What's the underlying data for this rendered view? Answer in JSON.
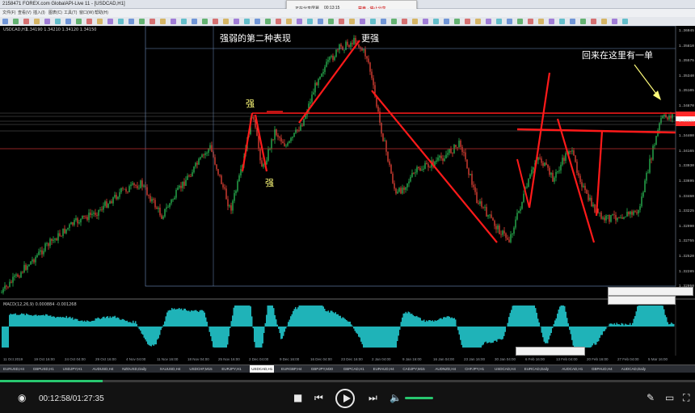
{
  "window": {
    "title": "2158471 FOREX.com GlobalAPI-Live 11 - [USDCAD,H1]",
    "center_text": "正在分享屏幕",
    "center_time": "00:13:15",
    "right_text": "禁声 · 停止分享"
  },
  "menu": [
    "文件(F)",
    "查看(V)",
    "插入(I)",
    "图表(C)",
    "工具(T)",
    "窗口(W)",
    "帮助(H)"
  ],
  "chart": {
    "symbol_label": "USDCAD,H1",
    "top_level_note": "1.34190 1.34210 1.34120 1.34150",
    "annotations": {
      "strong_second": "强弱的第二种表现",
      "stronger": "更强",
      "strong_upper": "强",
      "strong_lower": "强",
      "came_back": "回来在这里有一单"
    },
    "price_labels": [
      "1.36045",
      "1.35810",
      "1.35575",
      "1.35340",
      "1.35105",
      "1.34870",
      "1.34635",
      "1.34400",
      "1.34165",
      "1.33930",
      "1.33695",
      "1.33460",
      "1.33225",
      "1.32990",
      "1.32755",
      "1.32520",
      "1.32285",
      "1.32050"
    ],
    "date_labels": [
      "11 Oct 2019",
      "19 Oct 16:00",
      "24 Oct 04:00",
      "29 Oct 16:00",
      "4 Nov 04:00",
      "11 Nov 16:00",
      "18 Nov 04:00",
      "25 Nov 16:00",
      "2 Dec 04:00",
      "9 Dec 16:00",
      "16 Dec 04:00",
      "23 Dec 16:00",
      "2 Jan 04:00",
      "9 Jan 16:00",
      "16 Jan 04:00",
      "23 Jan 16:00",
      "30 Jan 04:00",
      "6 Feb 16:00",
      "13 Feb 04:00",
      "20 Feb 16:00",
      "27 Feb 04:00",
      "5 Mar 16:00"
    ],
    "macd_label": "MACD(12,26,9) 0.000884 -0.001268",
    "colors": {
      "bull": "#2ecf5d",
      "bear": "#ff4a3d",
      "line": "#ff1a1a",
      "macd": "#1fb3b8",
      "guide": "#6f8fbf"
    }
  },
  "tabs": [
    "EURUSD,H4",
    "GBPUSD,H1",
    "USDJPY,H1",
    "AUDUSD,H4",
    "NZDUSD,Daily",
    "XAUUSD,H4",
    "USDCHF,M15",
    "EURJPY,H1",
    "USDCAD,H1",
    "EURGBP,H4",
    "GBPJPY,M30",
    "GBPCAD,H1",
    "EURAUD,H4",
    "CADJPY,M15",
    "AUDNZD,H4",
    "CHFJPY,H1",
    "USDCAD,H4",
    "EURCAD,Daily",
    "AUDCAD,H1",
    "GBPAUD,H4",
    "AUDCAD,Daily"
  ],
  "active_tab": "USDCAD,H1",
  "player": {
    "time": "00:12:58/01:27:35",
    "progress": 0.148,
    "volume": 0.8
  }
}
